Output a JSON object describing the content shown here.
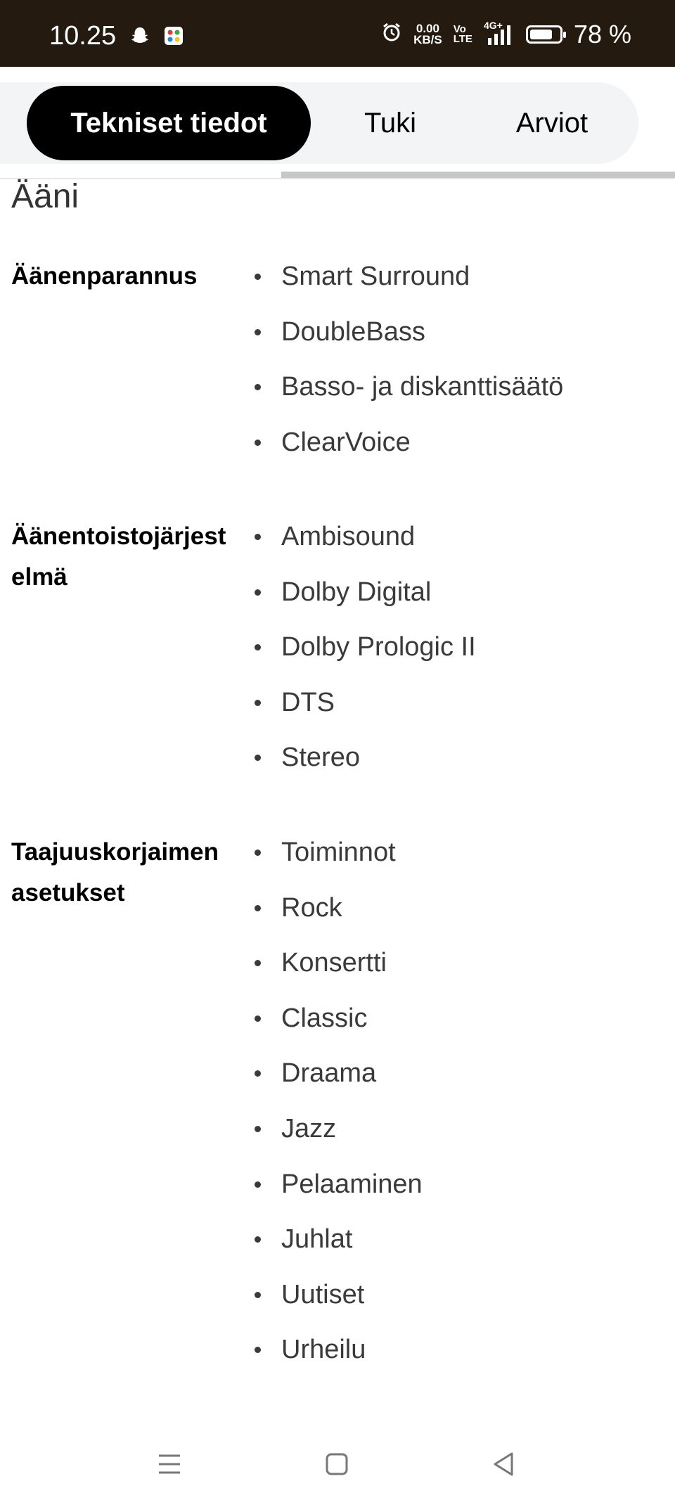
{
  "status_bar": {
    "time": "10.25",
    "left_icons": [
      "snapchat-icon",
      "app-grid-icon"
    ],
    "net_speed_value": "0.00",
    "net_speed_unit": "KB/S",
    "volte_top": "Vo",
    "volte_bottom": "LTE",
    "signal_label": "4G+",
    "battery_text": "78 %",
    "battery_level": 0.78
  },
  "tabs": [
    {
      "label": "Tekniset tiedot",
      "active": true
    },
    {
      "label": "Tuki",
      "active": false
    },
    {
      "label": "Arviot",
      "active": false
    }
  ],
  "section": {
    "title": "Ääni",
    "rows": [
      {
        "label": "Äänenparannus",
        "values": [
          "Smart Surround",
          "DoubleBass",
          "Basso- ja diskanttisäätö",
          "ClearVoice"
        ]
      },
      {
        "label": "Äänentoistojärjestelmä",
        "values": [
          "Ambisound",
          "Dolby Digital",
          "Dolby Prologic II",
          "DTS",
          "Stereo"
        ]
      },
      {
        "label": "Taajuuskorjaimen asetukset",
        "values": [
          "Toiminnot",
          "Rock",
          "Konsertti",
          "Classic",
          "Draama",
          "Jazz",
          "Pelaaminen",
          "Juhlat",
          "Uutiset",
          "Urheilu"
        ]
      }
    ]
  },
  "nav_bar": {
    "icons": [
      "menu-icon",
      "home-icon",
      "back-icon"
    ]
  }
}
